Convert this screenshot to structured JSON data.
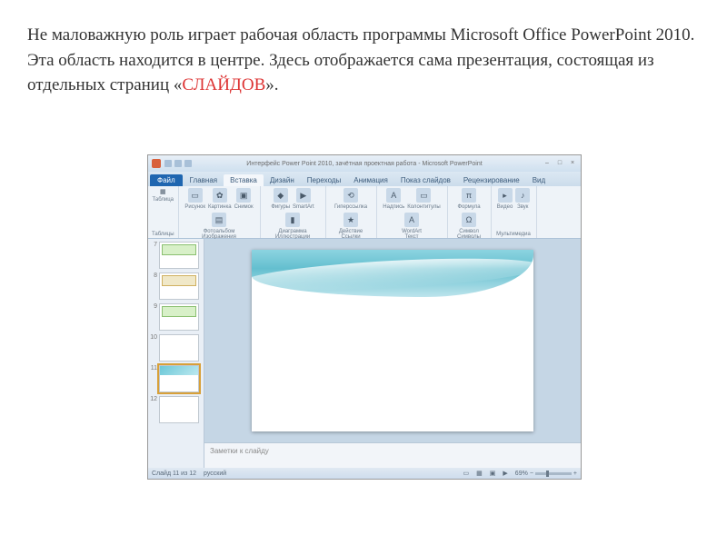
{
  "description": {
    "text1": "Не маловажную  роль играет рабочая область программы Microsoft Office PowerPoint 2010. Эта область находится в центре. Здесь отображается сама презентация, состоящая из отдельных страниц «",
    "highlight": "СЛАЙДОВ",
    "text2": "»."
  },
  "titlebar": {
    "title": "Интерфейс Power Point 2010, зачётная проектная работа  -  Microsoft PowerPoint"
  },
  "tabs": {
    "file": "Файл",
    "items": [
      {
        "label": "Главная"
      },
      {
        "label": "Вставка"
      },
      {
        "label": "Дизайн"
      },
      {
        "label": "Переходы"
      },
      {
        "label": "Анимация"
      },
      {
        "label": "Показ слайдов"
      },
      {
        "label": "Рецензирование"
      },
      {
        "label": "Вид"
      }
    ],
    "active": 1
  },
  "ribbon": {
    "groups": [
      {
        "label": "Таблицы",
        "big": "▦",
        "bigLbl": "Таблица"
      },
      {
        "label": "Изображения",
        "items": [
          "Рисунок",
          "Картинка",
          "Снимок",
          "Фотоальбом"
        ]
      },
      {
        "label": "Иллюстрации",
        "items": [
          "Фигуры",
          "SmartArt",
          "Диаграмма"
        ]
      },
      {
        "label": "Ссылки",
        "items": [
          "Гиперссылка",
          "Действие"
        ]
      },
      {
        "label": "Текст",
        "items": [
          "Надпись",
          "Колонтитулы",
          "WordArt"
        ]
      },
      {
        "label": "Символы",
        "items": [
          "Формула",
          "Символ"
        ],
        "glyphs": [
          "π",
          "Ω"
        ]
      },
      {
        "label": "Мультимедиа",
        "items": [
          "Видео",
          "Звук"
        ]
      }
    ]
  },
  "thumbnails": [
    {
      "num": "7"
    },
    {
      "num": "8"
    },
    {
      "num": "9"
    },
    {
      "num": "10"
    },
    {
      "num": "11"
    },
    {
      "num": "12"
    }
  ],
  "selectedThumb": 4,
  "notes": {
    "placeholder": "Заметки к слайду"
  },
  "statusbar": {
    "slide": "Слайд 11 из 12",
    "lang": "русский",
    "zoom": "69%"
  }
}
